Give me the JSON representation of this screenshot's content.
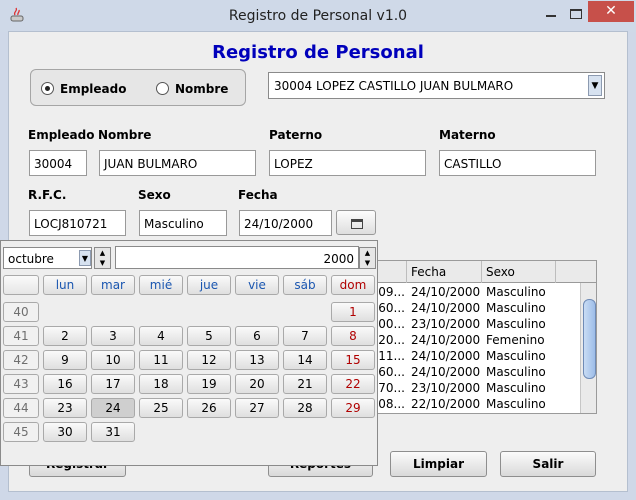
{
  "window": {
    "title": "Registro de Personal v1.0",
    "close": "✕"
  },
  "form": {
    "title": "Registro de Personal",
    "radio": {
      "empleado": "Empleado",
      "nombre": "Nombre"
    },
    "combo_value": "30004 LOPEZ CASTILLO JUAN BULMARO",
    "labels": {
      "empleado": "Empleado",
      "nombre": "Nombre",
      "paterno": "Paterno",
      "materno": "Materno",
      "rfc": "R.F.C.",
      "sexo": "Sexo",
      "fecha": "Fecha"
    },
    "values": {
      "empleado": "30004",
      "nombre": "JUAN BULMARO",
      "paterno": "LOPEZ",
      "materno": "CASTILLO",
      "rfc": "LOCJ810721",
      "sexo": "Masculino",
      "fecha": "24/10/2000"
    }
  },
  "table": {
    "headers": [
      "Fecha",
      "Sexo"
    ],
    "rows": [
      {
        "id": "09...",
        "fecha": "24/10/2000",
        "sexo": "Masculino"
      },
      {
        "id": "60...",
        "fecha": "24/10/2000",
        "sexo": "Masculino"
      },
      {
        "id": "00...",
        "fecha": "23/10/2000",
        "sexo": "Masculino"
      },
      {
        "id": "20...",
        "fecha": "24/10/2000",
        "sexo": "Femenino"
      },
      {
        "id": "11...",
        "fecha": "24/10/2000",
        "sexo": "Masculino"
      },
      {
        "id": "60...",
        "fecha": "24/10/2000",
        "sexo": "Masculino"
      },
      {
        "id": "70...",
        "fecha": "23/10/2000",
        "sexo": "Masculino"
      },
      {
        "id": "08...",
        "fecha": "22/10/2000",
        "sexo": "Masculino"
      }
    ]
  },
  "buttons": {
    "registrar": "Registrar",
    "reportes": "Reportes",
    "limpiar": "Limpiar",
    "salir": "Salir"
  },
  "calendar": {
    "month": "octubre",
    "year": "2000",
    "weekday_headers": [
      "lun",
      "mar",
      "mié",
      "jue",
      "vie",
      "sáb",
      "dom"
    ],
    "weeks": [
      {
        "week": "40",
        "days": [
          "",
          "",
          "",
          "",
          "",
          "",
          "1"
        ]
      },
      {
        "week": "41",
        "days": [
          "2",
          "3",
          "4",
          "5",
          "6",
          "7",
          "8"
        ]
      },
      {
        "week": "42",
        "days": [
          "9",
          "10",
          "11",
          "12",
          "13",
          "14",
          "15"
        ]
      },
      {
        "week": "43",
        "days": [
          "16",
          "17",
          "18",
          "19",
          "20",
          "21",
          "22"
        ]
      },
      {
        "week": "44",
        "days": [
          "23",
          "24",
          "25",
          "26",
          "27",
          "28",
          "29"
        ]
      },
      {
        "week": "45",
        "days": [
          "30",
          "31",
          "",
          "",
          "",
          "",
          ""
        ]
      }
    ],
    "selected_day": "24"
  },
  "colors": {
    "title_blue": "#0000bb",
    "sunday_red": "#b00000",
    "header_blue": "#1a56b0",
    "close_red": "#c7504a"
  }
}
